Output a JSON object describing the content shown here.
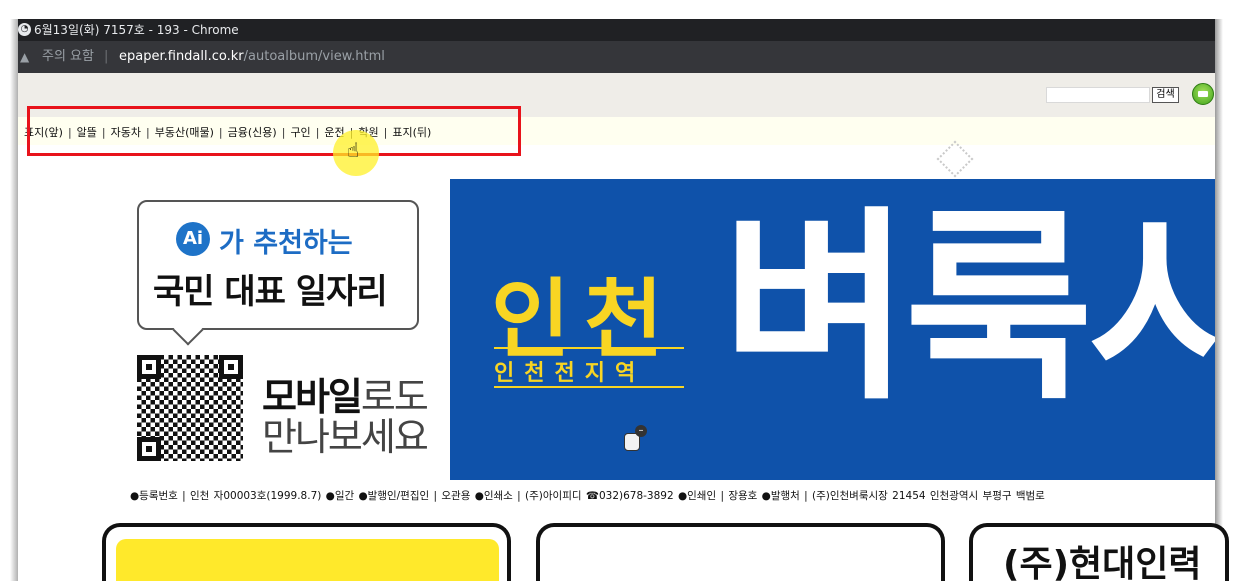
{
  "window": {
    "title": "6월13일(화) 7157호 - 193 - Chrome"
  },
  "address_bar": {
    "security_label": "주의 요함",
    "separator": "|",
    "url_host": "epaper.findall.co.kr",
    "url_path": "/autoalbum/view.html"
  },
  "toolbar": {
    "search_placeholder": "",
    "search_button": "검색"
  },
  "nav": {
    "items": [
      "표지(앞)",
      "알뜰",
      "자동차",
      "부동산(매물)",
      "금융(신용)",
      "구인",
      "운전",
      "학원",
      "표지(뒤)"
    ],
    "divider": "|"
  },
  "ad": {
    "ai_badge": "Ai",
    "line1": "가 추천하는",
    "line2": "국민 대표 일자리",
    "mobile_bold": "모바일",
    "mobile_light": "로도",
    "mobile_line2": "만나보세요"
  },
  "banner": {
    "region": "인천",
    "region_sub": "인천전지역",
    "name": "벼룩시"
  },
  "publisher_info": "●등록번호 | 인천 자00003호(1999.8.7)   ●일간   ●발행인/편집인 | 오관용   ●인쇄소 | (주)아이피디 ☎032)678-3892   ●인쇄인 | 장용호   ●발행처 | (주)인천벼룩시장 21454 인천광역시 부평구 백범로",
  "boxes": {
    "third_text": "(주)현대인력"
  },
  "colors": {
    "highlight": "#e8131b",
    "banner_blue": "#0f52aa",
    "banner_yellow": "#f8d523",
    "ai_blue": "#1d6cc4"
  }
}
